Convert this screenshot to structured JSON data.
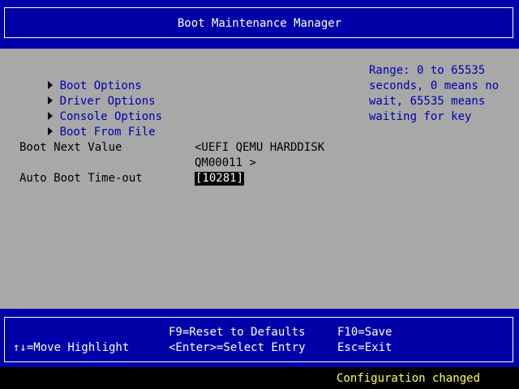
{
  "header": {
    "title": "Boot Maintenance Manager"
  },
  "menu": {
    "items": [
      {
        "label": "Boot Options"
      },
      {
        "label": "Driver Options"
      },
      {
        "label": "Console Options"
      },
      {
        "label": "Boot From File"
      }
    ]
  },
  "settings": {
    "boot_next": {
      "label": "Boot Next Value",
      "value_line1": "<UEFI QEMU HARDDISK",
      "value_line2": "QM00011 >"
    },
    "timeout": {
      "label": "Auto Boot Time-out",
      "value": "[10281]"
    }
  },
  "help": {
    "lines": [
      "Range: 0 to 65535",
      "seconds, 0 means no",
      "wait, 65535 means",
      "waiting for key"
    ]
  },
  "footer": {
    "move_highlight": "↑↓=Move Highlight",
    "reset_defaults": "F9=Reset to Defaults",
    "select_entry": "<Enter>=Select Entry",
    "save": "F10=Save",
    "exit": "Esc=Exit"
  },
  "status": {
    "message": "Configuration changed"
  },
  "colors": {
    "header_bg": "#0000a8",
    "body_bg": "#a8a8a8",
    "menu_text": "#0000a8",
    "status_text": "#ffff54"
  }
}
